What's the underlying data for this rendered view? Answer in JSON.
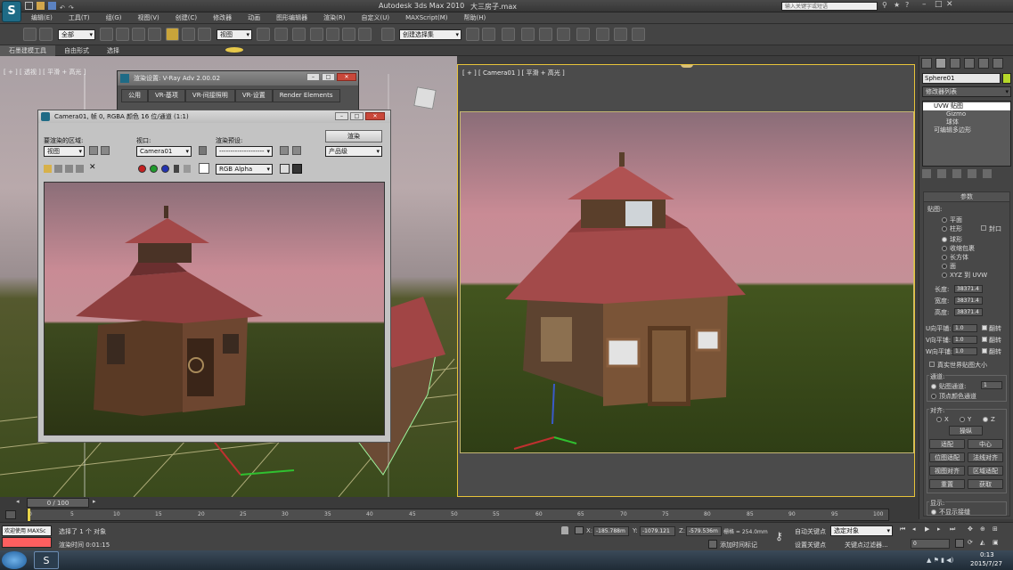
{
  "app": {
    "title": "Autodesk 3ds Max  2010",
    "file": "大三房子.max",
    "search_placeholder": "输入关键字或短语"
  },
  "menu": [
    "编辑(E)",
    "工具(T)",
    "组(G)",
    "视图(V)",
    "创建(C)",
    "修改器",
    "动画",
    "图形编辑器",
    "渲染(R)",
    "自定义(U)",
    "MAXScript(M)",
    "帮助(H)"
  ],
  "toolbar": {
    "filter_combo": "全部",
    "coord_combo": "视图",
    "selection_set": "创建选择集"
  },
  "ribbon": [
    "石墨建模工具",
    "自由形式",
    "选择"
  ],
  "left_viewport": {
    "label": "[ + ] [ 透视 ] [ 平滑 + 高光 ]"
  },
  "right_viewport": {
    "label": "[ + ] [ Camera01 ] [ 平滑 + 高光 ]"
  },
  "vray_dialog": {
    "title": "渲染设置: V-Ray Adv 2.00.02",
    "tabs": [
      "公用",
      "VR-基项",
      "VR-间接照明",
      "VR-设置",
      "Render Elements"
    ]
  },
  "render_window": {
    "title": "Camera01, 帧 0, RGBA 颜色 16 位/通道 (1:1)",
    "area_label": "要渲染的区域:",
    "area_value": "视图",
    "viewport_label": "视口:",
    "viewport_value": "Camera01",
    "preset_label": "渲染预设:",
    "preset_value": "--------------------",
    "render_button": "渲染",
    "output_value": "产品级",
    "channel_value": "RGB Alpha"
  },
  "command_panel": {
    "object_name": "Sphere01",
    "modifier_list": "修改器列表",
    "stack": [
      "UVW 贴图",
      "Gizmo",
      "球体",
      "可编辑多边形"
    ],
    "params_title": "参数",
    "mapping_label": "贴图:",
    "mapping_options": [
      "平面",
      "柱形",
      "封口",
      "球形",
      "收缩包裹",
      "长方体",
      "面",
      "XYZ 到 UVW"
    ],
    "length_label": "长度:",
    "length_value": "38371.4",
    "width_label": "宽度:",
    "width_value": "38371.4",
    "height_label": "高度:",
    "height_value": "38371.4",
    "u_tile_label": "U向平铺:",
    "u_tile": "1.0",
    "v_tile_label": "V向平铺:",
    "v_tile": "1.0",
    "w_tile_label": "W向平铺:",
    "w_tile": "1.0",
    "flip_label": "翻转",
    "real_world_label": "真实世界贴图大小",
    "channel_title": "通道:",
    "map_channel_label": "贴图通道:",
    "map_channel_value": "1",
    "vertex_color_label": "顶点颜色通道",
    "align_title": "对齐:",
    "axes": [
      "X",
      "Y",
      "Z"
    ],
    "manipulate": "操纵",
    "align_buttons": [
      "适配",
      "中心",
      "位图适配",
      "法线对齐",
      "视图对齐",
      "区域适配",
      "重置",
      "获取"
    ],
    "display_title": "显示:",
    "no_seams": "不显示接缝"
  },
  "timeline": {
    "frame": "0 / 100",
    "ticks": [
      "0",
      "5",
      "10",
      "15",
      "20",
      "25",
      "30",
      "35",
      "40",
      "45",
      "50",
      "55",
      "60",
      "65",
      "70",
      "75",
      "80",
      "85",
      "90",
      "95",
      "100"
    ]
  },
  "status": {
    "maxscript": "欢迎使用 MAXSc",
    "selected": "选择了 1 个 对象",
    "render_time": "渲染时间 0:01:15",
    "x_label": "X:",
    "x": "-185.788m",
    "y_label": "Y:",
    "y": "-1079.121",
    "z_label": "Z:",
    "z": "-579.536m",
    "grid": "栅格 = 254.0mm",
    "add_tag": "添加时间标记",
    "autokey": "自动关键点",
    "selected_obj": "选定对象",
    "setkey": "设置关键点",
    "key_filter": "关键点过滤器...",
    "frame_field": "0"
  },
  "taskbar": {
    "time": "0:13",
    "date": "2015/7/27"
  },
  "colors": {
    "accent": "#f3c33a",
    "sky": "#c98b95",
    "grass": "#3d4a1f"
  }
}
